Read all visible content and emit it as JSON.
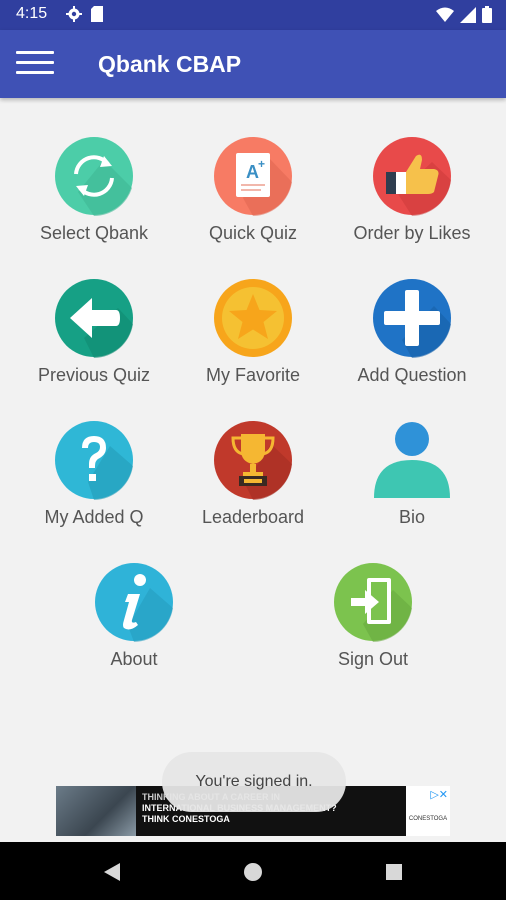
{
  "status_bar": {
    "time": "4:15",
    "icons_left": [
      "settings-icon",
      "sd-card-icon"
    ],
    "icons_right": [
      "wifi-icon",
      "cell-signal-icon",
      "battery-icon"
    ]
  },
  "app_bar": {
    "title": "Qbank CBAP",
    "menu_icon": "hamburger-menu-icon"
  },
  "menu": [
    {
      "label": "Select Qbank",
      "icon": "sync-icon",
      "color": "#4ccda8"
    },
    {
      "label": "Quick Quiz",
      "icon": "a-plus-document-icon",
      "color": "#f77b64"
    },
    {
      "label": "Order by Likes",
      "icon": "thumbs-up-icon",
      "color": "#e84a4a"
    },
    {
      "label": "Previous Quiz",
      "icon": "back-arrow-icon",
      "color": "#16a085"
    },
    {
      "label": "My Favorite",
      "icon": "star-icon",
      "color": "#f7a51b"
    },
    {
      "label": "Add Question",
      "icon": "plus-icon",
      "color": "#1f73c6"
    },
    {
      "label": "My Added Q",
      "icon": "question-icon",
      "color": "#2fb7d6"
    },
    {
      "label": "Leaderboard",
      "icon": "trophy-icon",
      "color": "#c0392b"
    },
    {
      "label": "Bio",
      "icon": "person-icon",
      "color": "#3ec6b2"
    },
    {
      "label": "About",
      "icon": "info-icon",
      "color": "#2fb3d8"
    },
    {
      "label": "Sign Out",
      "icon": "sign-out-icon",
      "color": "#7cc34e"
    }
  ],
  "toast": {
    "text": "You're signed in."
  },
  "ad": {
    "line1": "THINKING ABOUT A CAREER IN",
    "line2": "INTERNATIONAL BUSINESS MANAGEMENT?",
    "line3": "THINK CONESTOGA",
    "brand": "CONESTOGA"
  },
  "nav_bar": {
    "buttons": [
      "back-icon",
      "home-icon",
      "recents-icon"
    ]
  }
}
